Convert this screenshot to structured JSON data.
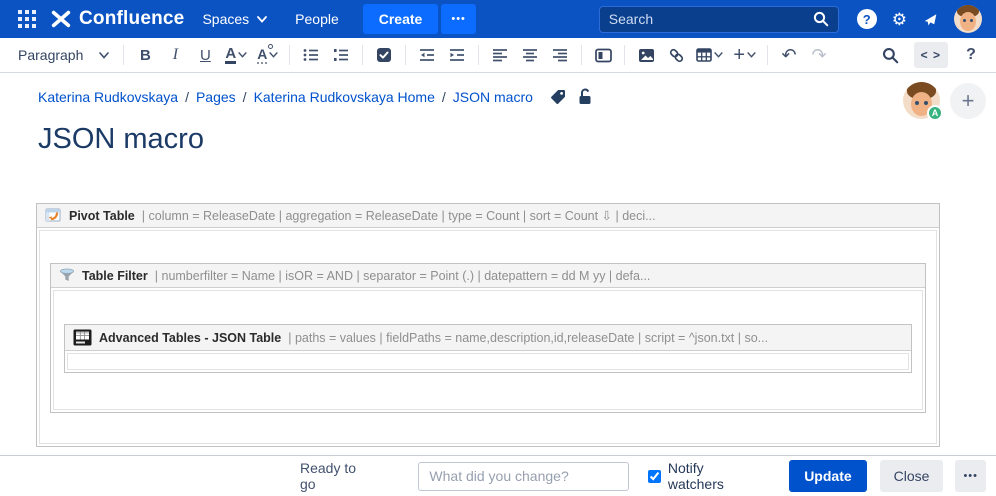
{
  "colors": {
    "topbar_bg": "#0B53C2",
    "create_button": "#0B6CFF",
    "search_field_bg": "#0A3F8E",
    "link": "#0052CC",
    "update_button": "#0052CC",
    "toolbar_icon": "#404F6B",
    "presence_badge": "#36B37E",
    "macro_header_bg": "#f4f4f4"
  },
  "topbar": {
    "logo_text": "Confluence",
    "nav": [
      {
        "label": "Spaces"
      },
      {
        "label": "People"
      }
    ],
    "create_label": "Create",
    "more_label": "•••",
    "search_placeholder": "Search"
  },
  "toolbar": {
    "paragraph_label": "Paragraph",
    "bold_label": "B",
    "italic_label": "I",
    "underline_label": "U",
    "color_label": "A",
    "style_label": "A",
    "undo_glyph": "↶",
    "redo_glyph": "↷",
    "plus_glyph": "+",
    "source_label": "< >",
    "help_label": "?"
  },
  "breadcrumb": {
    "separator": "/",
    "items": [
      "Katerina Rudkovskaya",
      "Pages",
      "Katerina Rudkovskaya Home",
      "JSON macro"
    ]
  },
  "page": {
    "title": "JSON macro",
    "presence_badge": "A"
  },
  "macros": [
    {
      "name": "Pivot Table",
      "params": "| column = ReleaseDate | aggregation = ReleaseDate | type = Count | sort = Count ⇩ | deci..."
    },
    {
      "name": "Table Filter",
      "params": "| numberfilter = Name | isOR = AND | separator = Point (.) | datepattern = dd M yy | defa..."
    },
    {
      "name": "Advanced Tables - JSON Table",
      "params": "| paths = values | fieldPaths = name,description,id,releaseDate | script = ^json.txt | so..."
    }
  ],
  "footer": {
    "status": "Ready to go",
    "comment_placeholder": "What did you change?",
    "notify_label": "Notify watchers",
    "notify_checked": true,
    "update_label": "Update",
    "close_label": "Close",
    "more_label": "•••"
  }
}
